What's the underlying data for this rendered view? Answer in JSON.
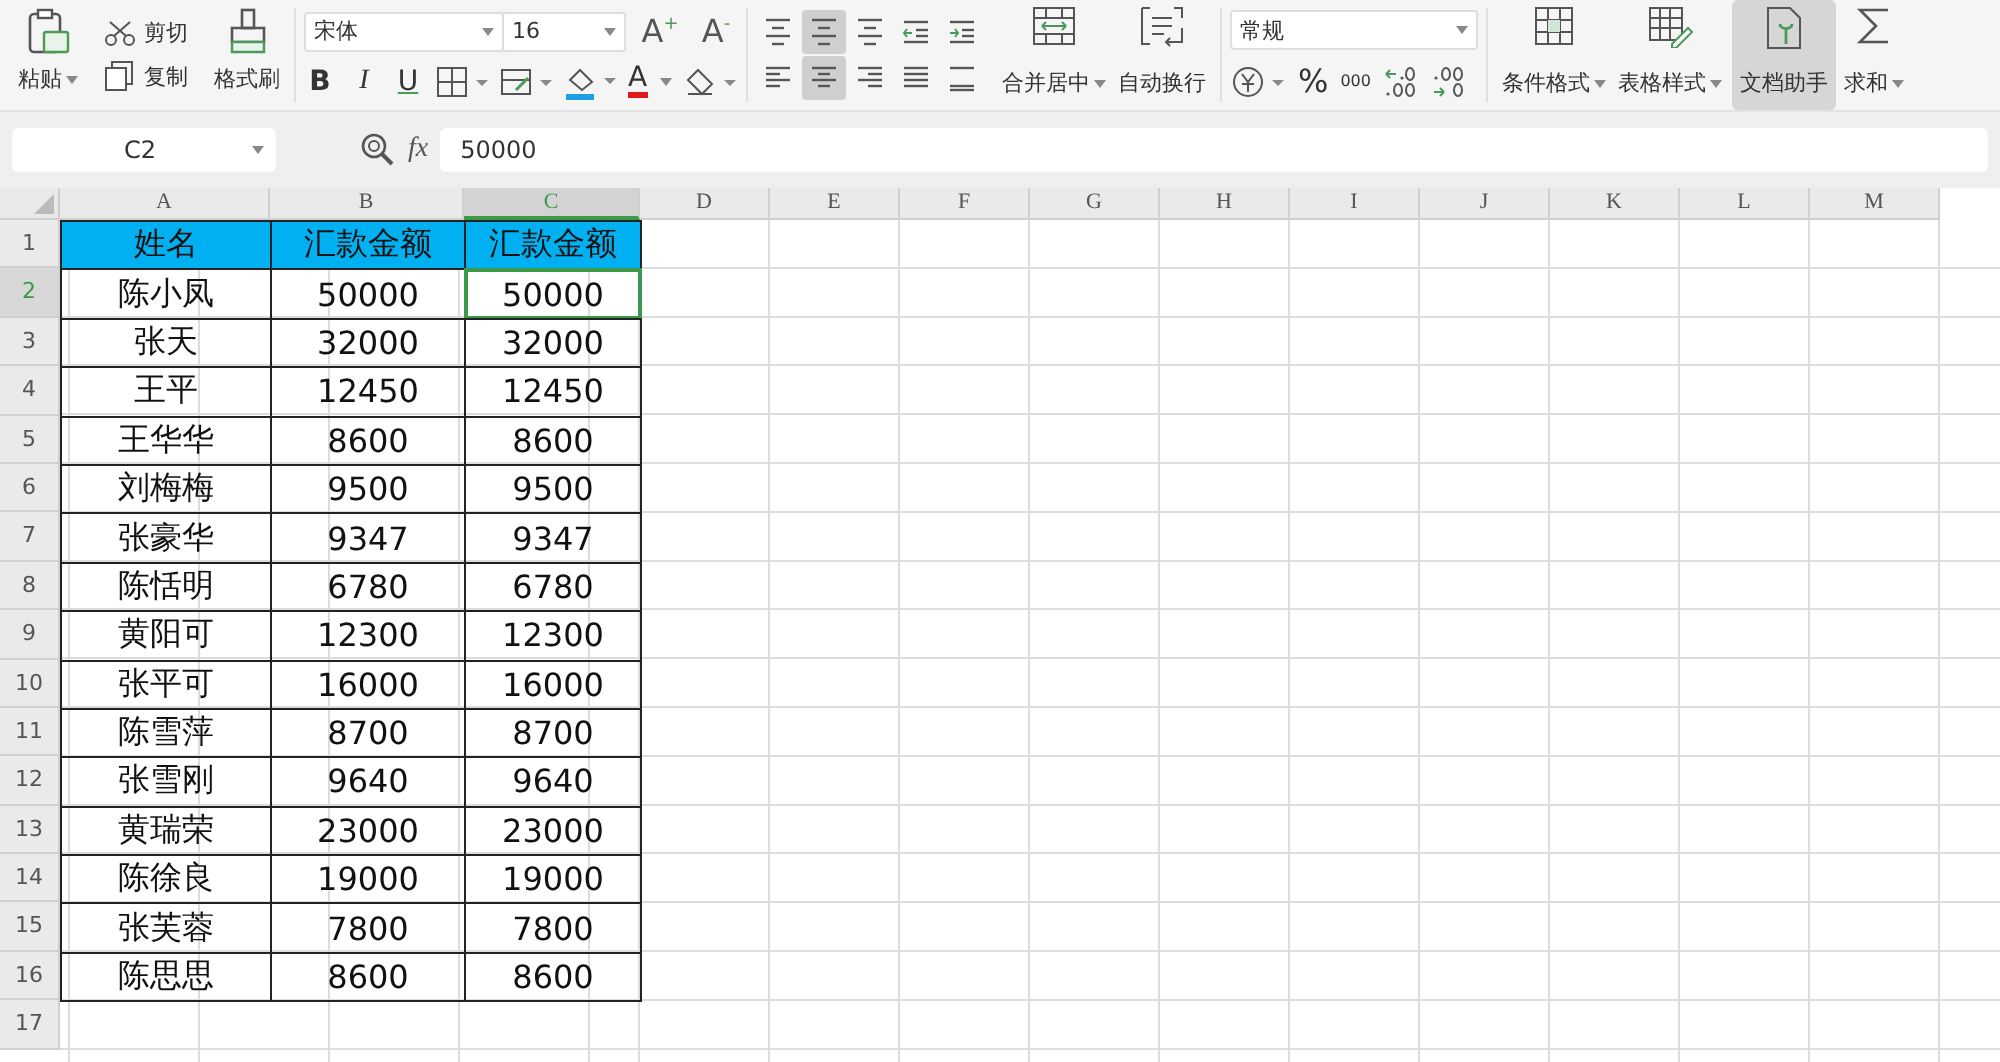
{
  "ribbon": {
    "paste": "粘贴",
    "cut": "剪切",
    "copy": "复制",
    "format_painter": "格式刷",
    "font_name": "宋体",
    "font_size": "16",
    "grow_font": "A$^{+}$",
    "shrink_font": "A$^{-}$",
    "bold": "B",
    "italic": "I",
    "underline": "U",
    "font_color": "A",
    "align_buttons": [
      {
        "kind": "top",
        "selected": false
      },
      {
        "kind": "middle",
        "selected": true
      },
      {
        "kind": "bottom",
        "selected": false
      },
      {
        "kind": "outdent",
        "selected": false
      },
      {
        "kind": "indent",
        "selected": false
      },
      {
        "kind": "left",
        "selected": false
      },
      {
        "kind": "center",
        "selected": true
      },
      {
        "kind": "right",
        "selected": false
      },
      {
        "kind": "justify",
        "selected": false
      },
      {
        "kind": "distributed",
        "selected": false
      }
    ],
    "merge_center": "合并居中",
    "wrap_text": "自动换行",
    "number_format": "常规",
    "percent": "%",
    "thousands": "000",
    "conditional_format": "条件格式",
    "table_style": "表格样式",
    "doc_assistant": {
      "label": "文档助手",
      "selected": true
    },
    "sum": "求和"
  },
  "formula_bar": {
    "name_box": "C2",
    "fx": "fx",
    "value": "50000"
  },
  "sheet": {
    "columns": [
      {
        "label": "A",
        "selected": false
      },
      {
        "label": "B",
        "selected": false
      },
      {
        "label": "C",
        "selected": true
      },
      {
        "label": "D",
        "selected": false
      },
      {
        "label": "E",
        "selected": false
      },
      {
        "label": "F",
        "selected": false
      },
      {
        "label": "G",
        "selected": false
      },
      {
        "label": "H",
        "selected": false
      },
      {
        "label": "I",
        "selected": false
      },
      {
        "label": "J",
        "selected": false
      },
      {
        "label": "K",
        "selected": false
      },
      {
        "label": "L",
        "selected": false
      },
      {
        "label": "M",
        "selected": false
      }
    ],
    "rows": [
      {
        "label": "1",
        "kind": "header",
        "selected": false,
        "cells": [
          {
            "text": "姓名",
            "selected": false
          },
          {
            "text": "汇款金额",
            "selected": false
          },
          {
            "text": "汇款金额",
            "selected": false
          }
        ]
      },
      {
        "label": "2",
        "kind": "data",
        "selected": true,
        "cells": [
          {
            "text": "陈小凤",
            "selected": false
          },
          {
            "text": "50000",
            "selected": false
          },
          {
            "text": "50000",
            "selected": true
          }
        ]
      },
      {
        "label": "3",
        "kind": "data",
        "selected": false,
        "cells": [
          {
            "text": "张天",
            "selected": false
          },
          {
            "text": "32000",
            "selected": false
          },
          {
            "text": "32000",
            "selected": false
          }
        ]
      },
      {
        "label": "4",
        "kind": "data",
        "selected": false,
        "cells": [
          {
            "text": "王平",
            "selected": false
          },
          {
            "text": "12450",
            "selected": false
          },
          {
            "text": "12450",
            "selected": false
          }
        ]
      },
      {
        "label": "5",
        "kind": "data",
        "selected": false,
        "cells": [
          {
            "text": "王华华",
            "selected": false
          },
          {
            "text": "8600",
            "selected": false
          },
          {
            "text": "8600",
            "selected": false
          }
        ]
      },
      {
        "label": "6",
        "kind": "data",
        "selected": false,
        "cells": [
          {
            "text": "刘梅梅",
            "selected": false
          },
          {
            "text": "9500",
            "selected": false
          },
          {
            "text": "9500",
            "selected": false
          }
        ]
      },
      {
        "label": "7",
        "kind": "data",
        "selected": false,
        "cells": [
          {
            "text": "张豪华",
            "selected": false
          },
          {
            "text": "9347",
            "selected": false
          },
          {
            "text": "9347",
            "selected": false
          }
        ]
      },
      {
        "label": "8",
        "kind": "data",
        "selected": false,
        "cells": [
          {
            "text": "陈恬明",
            "selected": false
          },
          {
            "text": "6780",
            "selected": false
          },
          {
            "text": "6780",
            "selected": false
          }
        ]
      },
      {
        "label": "9",
        "kind": "data",
        "selected": false,
        "cells": [
          {
            "text": "黄阳可",
            "selected": false
          },
          {
            "text": "12300",
            "selected": false
          },
          {
            "text": "12300",
            "selected": false
          }
        ]
      },
      {
        "label": "10",
        "kind": "data",
        "selected": false,
        "cells": [
          {
            "text": "张平可",
            "selected": false
          },
          {
            "text": "16000",
            "selected": false
          },
          {
            "text": "16000",
            "selected": false
          }
        ]
      },
      {
        "label": "11",
        "kind": "data",
        "selected": false,
        "cells": [
          {
            "text": "陈雪萍",
            "selected": false
          },
          {
            "text": "8700",
            "selected": false
          },
          {
            "text": "8700",
            "selected": false
          }
        ]
      },
      {
        "label": "12",
        "kind": "data",
        "selected": false,
        "cells": [
          {
            "text": "张雪刚",
            "selected": false
          },
          {
            "text": "9640",
            "selected": false
          },
          {
            "text": "9640",
            "selected": false
          }
        ]
      },
      {
        "label": "13",
        "kind": "data",
        "selected": false,
        "cells": [
          {
            "text": "黄瑞荣",
            "selected": false
          },
          {
            "text": "23000",
            "selected": false
          },
          {
            "text": "23000",
            "selected": false
          }
        ]
      },
      {
        "label": "14",
        "kind": "data",
        "selected": false,
        "cells": [
          {
            "text": "陈徐良",
            "selected": false
          },
          {
            "text": "19000",
            "selected": false
          },
          {
            "text": "19000",
            "selected": false
          }
        ]
      },
      {
        "label": "15",
        "kind": "data",
        "selected": false,
        "cells": [
          {
            "text": "张芙蓉",
            "selected": false
          },
          {
            "text": "7800",
            "selected": false
          },
          {
            "text": "7800",
            "selected": false
          }
        ]
      },
      {
        "label": "16",
        "kind": "data",
        "selected": false,
        "cells": [
          {
            "text": "陈思思",
            "selected": false
          },
          {
            "text": "8600",
            "selected": false
          },
          {
            "text": "8600",
            "selected": false
          }
        ]
      },
      {
        "label": "17",
        "selected": false,
        "cells": []
      }
    ]
  }
}
